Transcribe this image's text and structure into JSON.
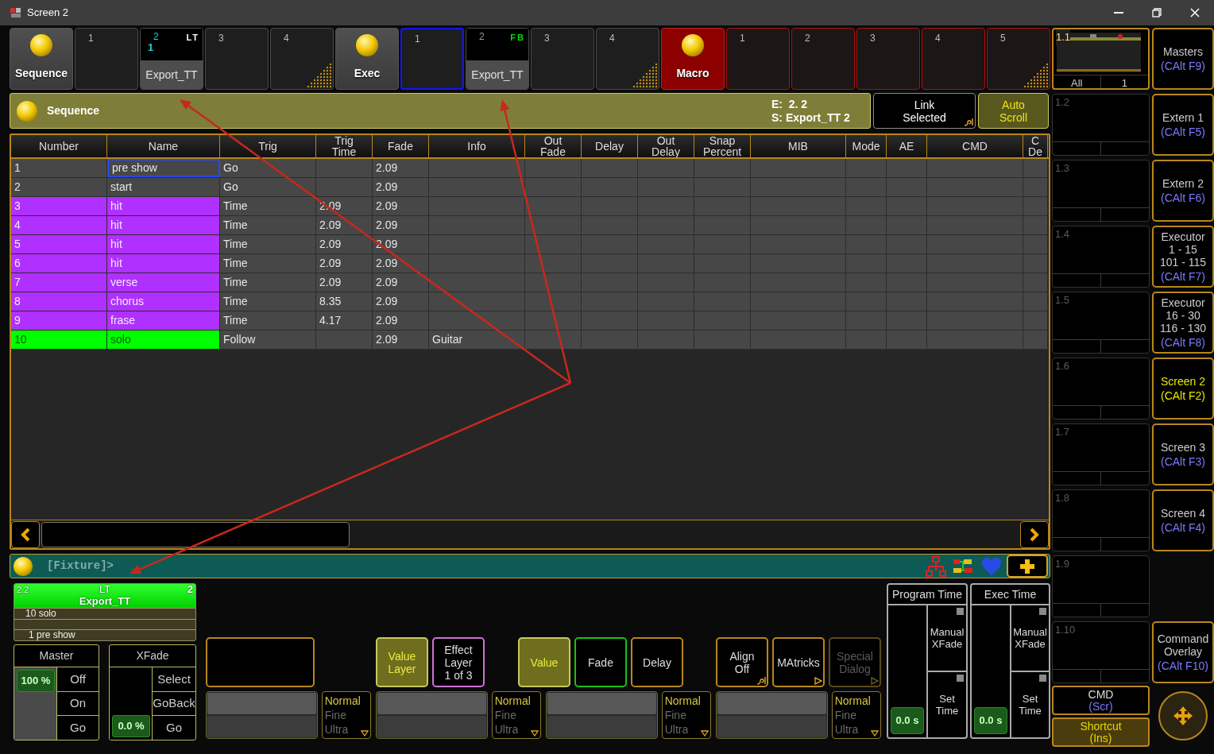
{
  "window": {
    "title": "Screen 2"
  },
  "executors": [
    {
      "kind": "pool",
      "label": "Sequence",
      "selected": false,
      "dots": false
    },
    {
      "kind": "empty",
      "number": "1",
      "selected": false,
      "dots": false
    },
    {
      "kind": "assigned",
      "number": "2",
      "cue": "1",
      "type": "LT",
      "color": "#ffffff",
      "name": "Export_TT",
      "active": true,
      "selected": false,
      "dots": false
    },
    {
      "kind": "empty",
      "number": "3",
      "selected": false,
      "dots": false
    },
    {
      "kind": "empty",
      "number": "4",
      "selected": false,
      "dots": true
    },
    {
      "kind": "pool",
      "label": "Exec",
      "selected": false,
      "dots": false
    },
    {
      "kind": "empty",
      "number": "1",
      "selected": true,
      "dots": false
    },
    {
      "kind": "assigned",
      "number": "2",
      "type": "FB",
      "color": "#00e000",
      "name": "Export_TT",
      "active": false,
      "selected": false,
      "dots": false
    },
    {
      "kind": "empty",
      "number": "3",
      "selected": false,
      "dots": false
    },
    {
      "kind": "empty",
      "number": "4",
      "selected": false,
      "dots": true
    },
    {
      "kind": "macro",
      "label": "Macro",
      "selected": false,
      "dots": false
    },
    {
      "kind": "macroslot",
      "number": "1",
      "selected": false,
      "dots": false
    },
    {
      "kind": "macroslot",
      "number": "2",
      "selected": false,
      "dots": false
    },
    {
      "kind": "macroslot",
      "number": "3",
      "selected": false,
      "dots": false
    },
    {
      "kind": "macroslot",
      "number": "4",
      "selected": false,
      "dots": false
    },
    {
      "kind": "macroslot",
      "number": "5",
      "selected": false,
      "dots": true
    }
  ],
  "sheet": {
    "title": "Sequence",
    "executor": "E:  2. 2",
    "sequence": "S: Export_TT 2",
    "buttons": [
      {
        "label": "Link\nSelected",
        "on": false,
        "has_menu": true
      },
      {
        "label": "Auto\nScroll",
        "on": true,
        "has_menu": false
      }
    ]
  },
  "table": {
    "columns": [
      "Number",
      "Name",
      "Trig",
      "Trig\nTime",
      "Fade",
      "Info",
      "Out\nFade",
      "Delay",
      "Out\nDelay",
      "Snap\nPercent",
      "MIB",
      "Mode",
      "AE",
      "CMD",
      "C\nDe"
    ],
    "rows": [
      {
        "number": "1",
        "name": "pre show",
        "trig": "Go",
        "fade": "2.09",
        "selected": true
      },
      {
        "number": "2",
        "name": "start",
        "trig": "Go",
        "fade": "2.09",
        "selected": false
      },
      {
        "number": "3",
        "name": "hit",
        "trig": "Time",
        "trig_time": "2.09",
        "fade": "2.09",
        "color": "#b030ff",
        "selected": false
      },
      {
        "number": "4",
        "name": "hit",
        "trig": "Time",
        "trig_time": "2.09",
        "fade": "2.09",
        "color": "#b030ff",
        "selected": false
      },
      {
        "number": "5",
        "name": "hit",
        "trig": "Time",
        "trig_time": "2.09",
        "fade": "2.09",
        "color": "#b030ff",
        "selected": false
      },
      {
        "number": "6",
        "name": "hit",
        "trig": "Time",
        "trig_time": "2.09",
        "fade": "2.09",
        "color": "#b030ff",
        "selected": false
      },
      {
        "number": "7",
        "name": "verse",
        "trig": "Time",
        "trig_time": "2.09",
        "fade": "2.09",
        "color": "#b030ff",
        "selected": false
      },
      {
        "number": "8",
        "name": "chorus",
        "trig": "Time",
        "trig_time": "8.35",
        "fade": "2.09",
        "color": "#b030ff",
        "selected": false
      },
      {
        "number": "9",
        "name": "frase",
        "trig": "Time",
        "trig_time": "4.17",
        "fade": "2.09",
        "color": "#b030ff",
        "selected": false
      },
      {
        "number": "10",
        "name": "solo",
        "trig": "Follow",
        "fade": "2.09",
        "info": "Guitar",
        "color": "#00ff00",
        "selected": false
      }
    ]
  },
  "command_line": {
    "prompt": "[Fixture]>"
  },
  "executor_card": {
    "number": "2.2",
    "type": "LT",
    "page": "2",
    "name": "Export_TT",
    "current_cue": "10 solo",
    "next_cue": "1 pre show"
  },
  "fader_panels": [
    {
      "title": "Master",
      "reading": "100 %",
      "full": true,
      "buttons": [
        "Off",
        "On",
        "Go"
      ]
    },
    {
      "title": "XFade",
      "reading": "0.0 %",
      "full": false,
      "buttons": [
        "Select",
        "GoBack",
        "Go"
      ]
    }
  ],
  "button_groups": [
    [
      {
        "kind": "blank",
        "disabled": false
      }
    ],
    [
      {
        "kind": "active",
        "label": "Value\nLayer",
        "disabled": false
      },
      {
        "kind": "layer",
        "label": "Effect\nLayer\n1 of 3",
        "disabled": false
      }
    ],
    [
      {
        "kind": "active",
        "label": "Value",
        "disabled": false
      },
      {
        "kind": "fade",
        "label": "Fade",
        "disabled": false
      },
      {
        "kind": "normal",
        "label": "Delay",
        "disabled": false
      }
    ],
    [
      {
        "kind": "normal",
        "label": "Align\nOff",
        "has_menu": true,
        "disabled": false
      },
      {
        "kind": "normal",
        "label": "MAtricks",
        "has_dialog": true,
        "disabled": false
      },
      {
        "kind": "normal",
        "label": "Special\nDialog",
        "has_dialog": true,
        "disabled": true
      }
    ]
  ],
  "encoders": [
    {
      "resolutions": [
        {
          "label": "Normal",
          "selected": true
        },
        {
          "label": "Fine",
          "selected": false
        },
        {
          "label": "Ultra",
          "selected": false
        }
      ]
    },
    {
      "resolutions": [
        {
          "label": "Normal",
          "selected": true
        },
        {
          "label": "Fine",
          "selected": false
        },
        {
          "label": "Ultra",
          "selected": false
        }
      ]
    },
    {
      "resolutions": [
        {
          "label": "Normal",
          "selected": true
        },
        {
          "label": "Fine",
          "selected": false
        },
        {
          "label": "Ultra",
          "selected": false
        }
      ]
    },
    {
      "resolutions": [
        {
          "label": "Normal",
          "selected": true
        },
        {
          "label": "Fine",
          "selected": false
        },
        {
          "label": "Ultra",
          "selected": false
        }
      ]
    }
  ],
  "time_panels": [
    {
      "title": "Program Time",
      "reading": "0.0 s",
      "buttons": [
        "Manual\nXFade",
        "Set\nTime"
      ]
    },
    {
      "title": "Exec Time",
      "reading": "0.0 s",
      "buttons": [
        "Manual\nXFade",
        "Set\nTime"
      ]
    }
  ],
  "previews": [
    {
      "label": "1.1",
      "footer": [
        "All",
        "1"
      ],
      "selected": true
    },
    {
      "label": "1.2",
      "selected": false
    },
    {
      "label": "1.3",
      "selected": false
    },
    {
      "label": "1.4",
      "selected": false
    },
    {
      "label": "1.5",
      "selected": false
    },
    {
      "label": "1.6",
      "selected": false
    },
    {
      "label": "1.7",
      "selected": false
    },
    {
      "label": "1.8",
      "selected": false
    },
    {
      "label": "1.9",
      "selected": false
    },
    {
      "label": "1.10",
      "selected": false
    }
  ],
  "preview_buttons": [
    {
      "label": "CMD",
      "shortcut": "(Scr)",
      "on": false
    },
    {
      "label": "Shortcut",
      "shortcut": "(Ins)",
      "on": true
    }
  ],
  "views": [
    {
      "kind": "button",
      "label": "Masters",
      "shortcut": "(CAlt F9)",
      "selected": false
    },
    {
      "kind": "button",
      "label": "Extern 1",
      "shortcut": "(CAlt F5)",
      "selected": false
    },
    {
      "kind": "button",
      "label": "Extern 2",
      "shortcut": "(CAlt F6)",
      "selected": false
    },
    {
      "kind": "button",
      "label": "Executor\n1 - 15\n101 - 115",
      "shortcut": "(CAlt F7)",
      "selected": false
    },
    {
      "kind": "button",
      "label": "Executor\n16 - 30\n116 - 130",
      "shortcut": "(CAlt F8)",
      "selected": false
    },
    {
      "kind": "button",
      "label": "Screen 2",
      "shortcut": "(CAlt F2)",
      "selected": true
    },
    {
      "kind": "button",
      "label": "Screen 3",
      "shortcut": "(CAlt F3)",
      "selected": false
    },
    {
      "kind": "button",
      "label": "Screen 4",
      "shortcut": "(CAlt F4)",
      "selected": false
    },
    {
      "kind": "blank"
    },
    {
      "kind": "button",
      "label": "Command\nOverlay",
      "shortcut": "(CAlt F10)",
      "selected": false
    }
  ]
}
